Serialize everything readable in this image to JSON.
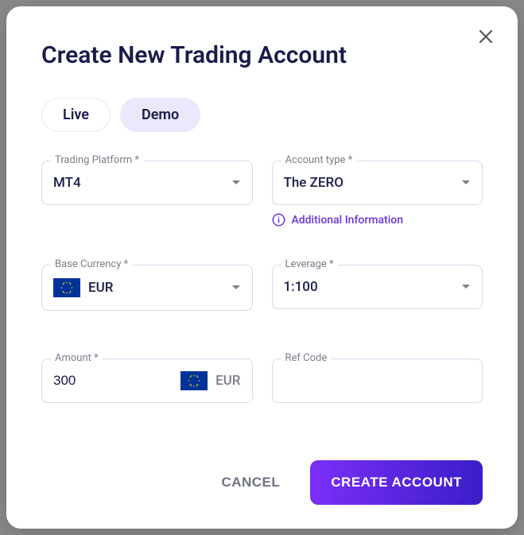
{
  "modal": {
    "title": "Create New Trading Account",
    "tabs": {
      "live": "Live",
      "demo": "Demo"
    },
    "fields": {
      "trading_platform": {
        "label": "Trading Platform *",
        "value": "MT4"
      },
      "account_type": {
        "label": "Account type *",
        "value": "The ZERO",
        "info": "Additional Information"
      },
      "base_currency": {
        "label": "Base Currency *",
        "value": "EUR"
      },
      "leverage": {
        "label": "Leverage *",
        "value": "1:100"
      },
      "amount": {
        "label": "Amount *",
        "value": "300",
        "currency_suffix": "EUR"
      },
      "ref_code": {
        "label": "Ref Code",
        "value": ""
      }
    },
    "actions": {
      "cancel": "CANCEL",
      "create": "CREATE ACCOUNT"
    }
  }
}
